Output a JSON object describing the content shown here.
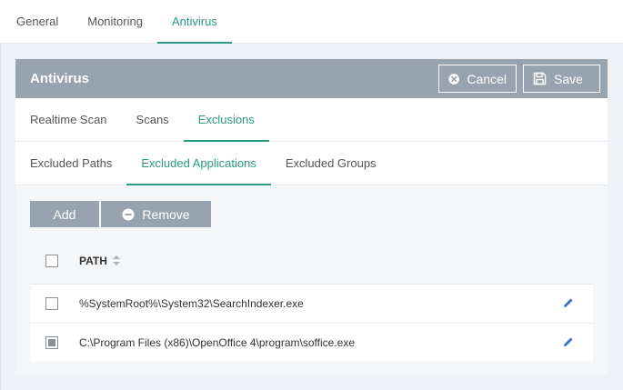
{
  "top_tabs": [
    "General",
    "Monitoring",
    "Antivirus"
  ],
  "panel": {
    "title": "Antivirus",
    "cancel_label": "Cancel",
    "save_label": "Save"
  },
  "sub_tabs": [
    "Realtime Scan",
    "Scans",
    "Exclusions"
  ],
  "exclusion_tabs": [
    "Excluded Paths",
    "Excluded Applications",
    "Excluded Groups"
  ],
  "actions": {
    "add_label": "Add",
    "remove_label": "Remove"
  },
  "table": {
    "column_path": "PATH",
    "rows": [
      {
        "path": "%SystemRoot%\\System32\\SearchIndexer.exe",
        "checked": false
      },
      {
        "path": "C:\\Program Files (x86)\\OpenOffice 4\\program\\soffice.exe",
        "checked": true
      }
    ]
  },
  "colors": {
    "accent": "#2b9b82",
    "header_bg": "#97a4b0",
    "edit_icon": "#3b6fc4"
  }
}
